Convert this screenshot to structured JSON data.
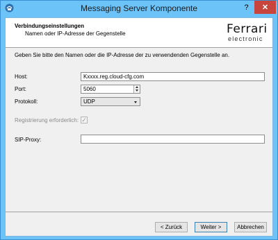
{
  "window": {
    "title": "Messaging Server Komponente",
    "help_label": "?",
    "close_label": "✕",
    "app_icon": "app-logo-icon"
  },
  "header": {
    "title": "Verbindungseinstellungen",
    "subtitle": "Namen oder IP-Adresse der Gegenstelle",
    "logo_main": "Ferrari",
    "logo_sub": "electronic"
  },
  "intro": "Geben Sie bitte den Namen oder die IP-Adresse der zu verwendenden Gegenstelle an.",
  "form": {
    "host_label": "Host:",
    "host_value": "Kxxxx.reg.cloud-cfg.com",
    "port_label": "Port:",
    "port_value": "5060",
    "protocol_label": "Protokoll:",
    "protocol_value": "UDP",
    "registration_label": "Registrierung erforderlich:",
    "registration_checked": true,
    "registration_check_glyph": "✓",
    "sip_proxy_label": "SIP-Proxy:",
    "sip_proxy_value": ""
  },
  "buttons": {
    "back": "< Zurück",
    "next": "Weiter >",
    "cancel": "Abbrechen"
  }
}
